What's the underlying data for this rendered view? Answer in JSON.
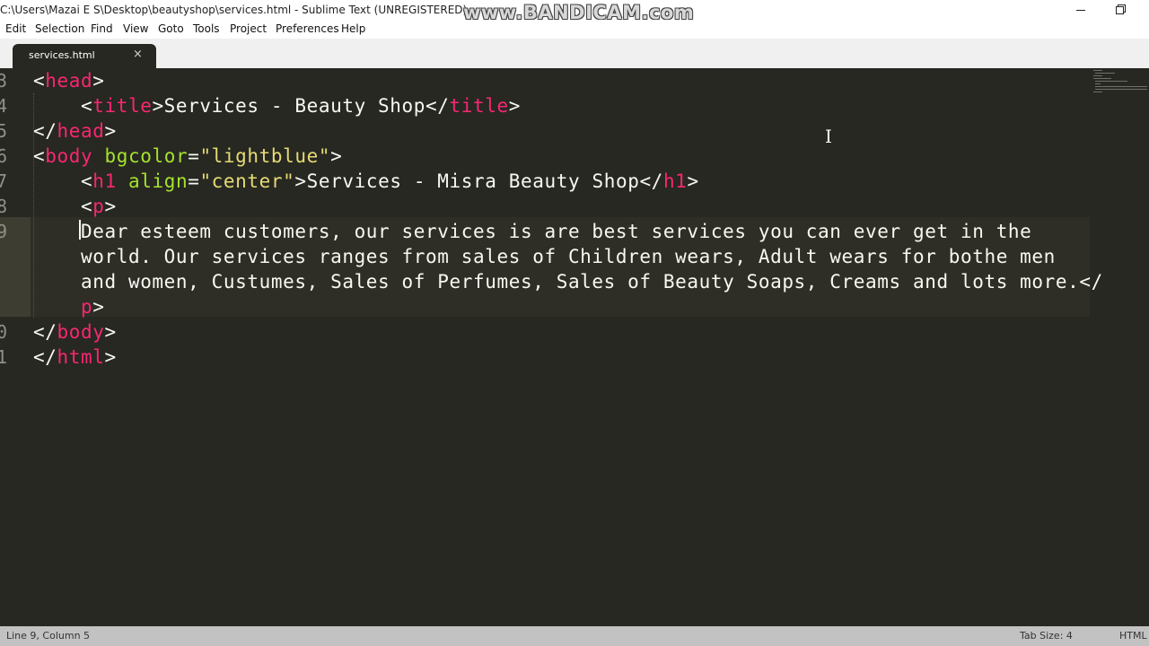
{
  "window": {
    "title": "C:\\Users\\Mazai E S\\Desktop\\beautyshop\\services.html - Sublime Text (UNREGISTERED)",
    "watermark": "www.BANDICAM.com"
  },
  "menu": [
    "Edit",
    "Selection",
    "Find",
    "View",
    "Goto",
    "Tools",
    "Project",
    "Preferences",
    "Help"
  ],
  "tabs": [
    {
      "label": "services.html",
      "close_glyph": "×"
    }
  ],
  "editor": {
    "line_numbers": [
      "3",
      "4",
      "5",
      "6",
      "7",
      "8",
      "9",
      "",
      "",
      "",
      "0",
      "1"
    ],
    "lines": [
      [
        {
          "t": "<"
        },
        {
          "t": "head",
          "k": "tag"
        },
        {
          "t": ">"
        }
      ],
      [
        {
          "t": "    <"
        },
        {
          "t": "title",
          "k": "tag"
        },
        {
          "t": ">Services - Beauty Shop</"
        },
        {
          "t": "title",
          "k": "tag"
        },
        {
          "t": ">"
        }
      ],
      [
        {
          "t": "</"
        },
        {
          "t": "head",
          "k": "tag"
        },
        {
          "t": ">"
        }
      ],
      [
        {
          "t": "<"
        },
        {
          "t": "body",
          "k": "tag"
        },
        {
          "t": " "
        },
        {
          "t": "bgcolor",
          "k": "attr"
        },
        {
          "t": "="
        },
        {
          "t": "\"lightblue\"",
          "k": "str"
        },
        {
          "t": ">"
        }
      ],
      [
        {
          "t": "    <"
        },
        {
          "t": "h1",
          "k": "tag"
        },
        {
          "t": " "
        },
        {
          "t": "align",
          "k": "attr"
        },
        {
          "t": "="
        },
        {
          "t": "\"center\"",
          "k": "str"
        },
        {
          "t": ">Services - Misra Beauty Shop</"
        },
        {
          "t": "h1",
          "k": "tag"
        },
        {
          "t": ">"
        }
      ],
      [
        {
          "t": "    <"
        },
        {
          "t": "p",
          "k": "tag"
        },
        {
          "t": ">"
        }
      ],
      [
        {
          "t": "    Dear esteem customers, our services is are best services you can ever get in the"
        }
      ],
      [
        {
          "t": "    world. Our services ranges from sales of Children wears, Adult wears for bothe men"
        }
      ],
      [
        {
          "t": "    and women, Custumes, Sales of Perfumes, Sales of Beauty Soaps, Creams and lots more.</"
        }
      ],
      [
        {
          "t": "    "
        },
        {
          "t": "p",
          "k": "tag"
        },
        {
          "t": ">"
        }
      ],
      [
        {
          "t": "</"
        },
        {
          "t": "body",
          "k": "tag"
        },
        {
          "t": ">"
        }
      ],
      [
        {
          "t": "</"
        },
        {
          "t": "html",
          "k": "tag"
        },
        {
          "t": ">"
        }
      ]
    ]
  },
  "status": {
    "position": "Line 9, Column 5",
    "tab_size": "Tab Size: 4",
    "syntax": "HTML"
  },
  "colors": {
    "background": "#272822",
    "tag": "#f92672",
    "attribute": "#a6e22e",
    "string": "#e6db74",
    "text": "#f8f8f2"
  }
}
